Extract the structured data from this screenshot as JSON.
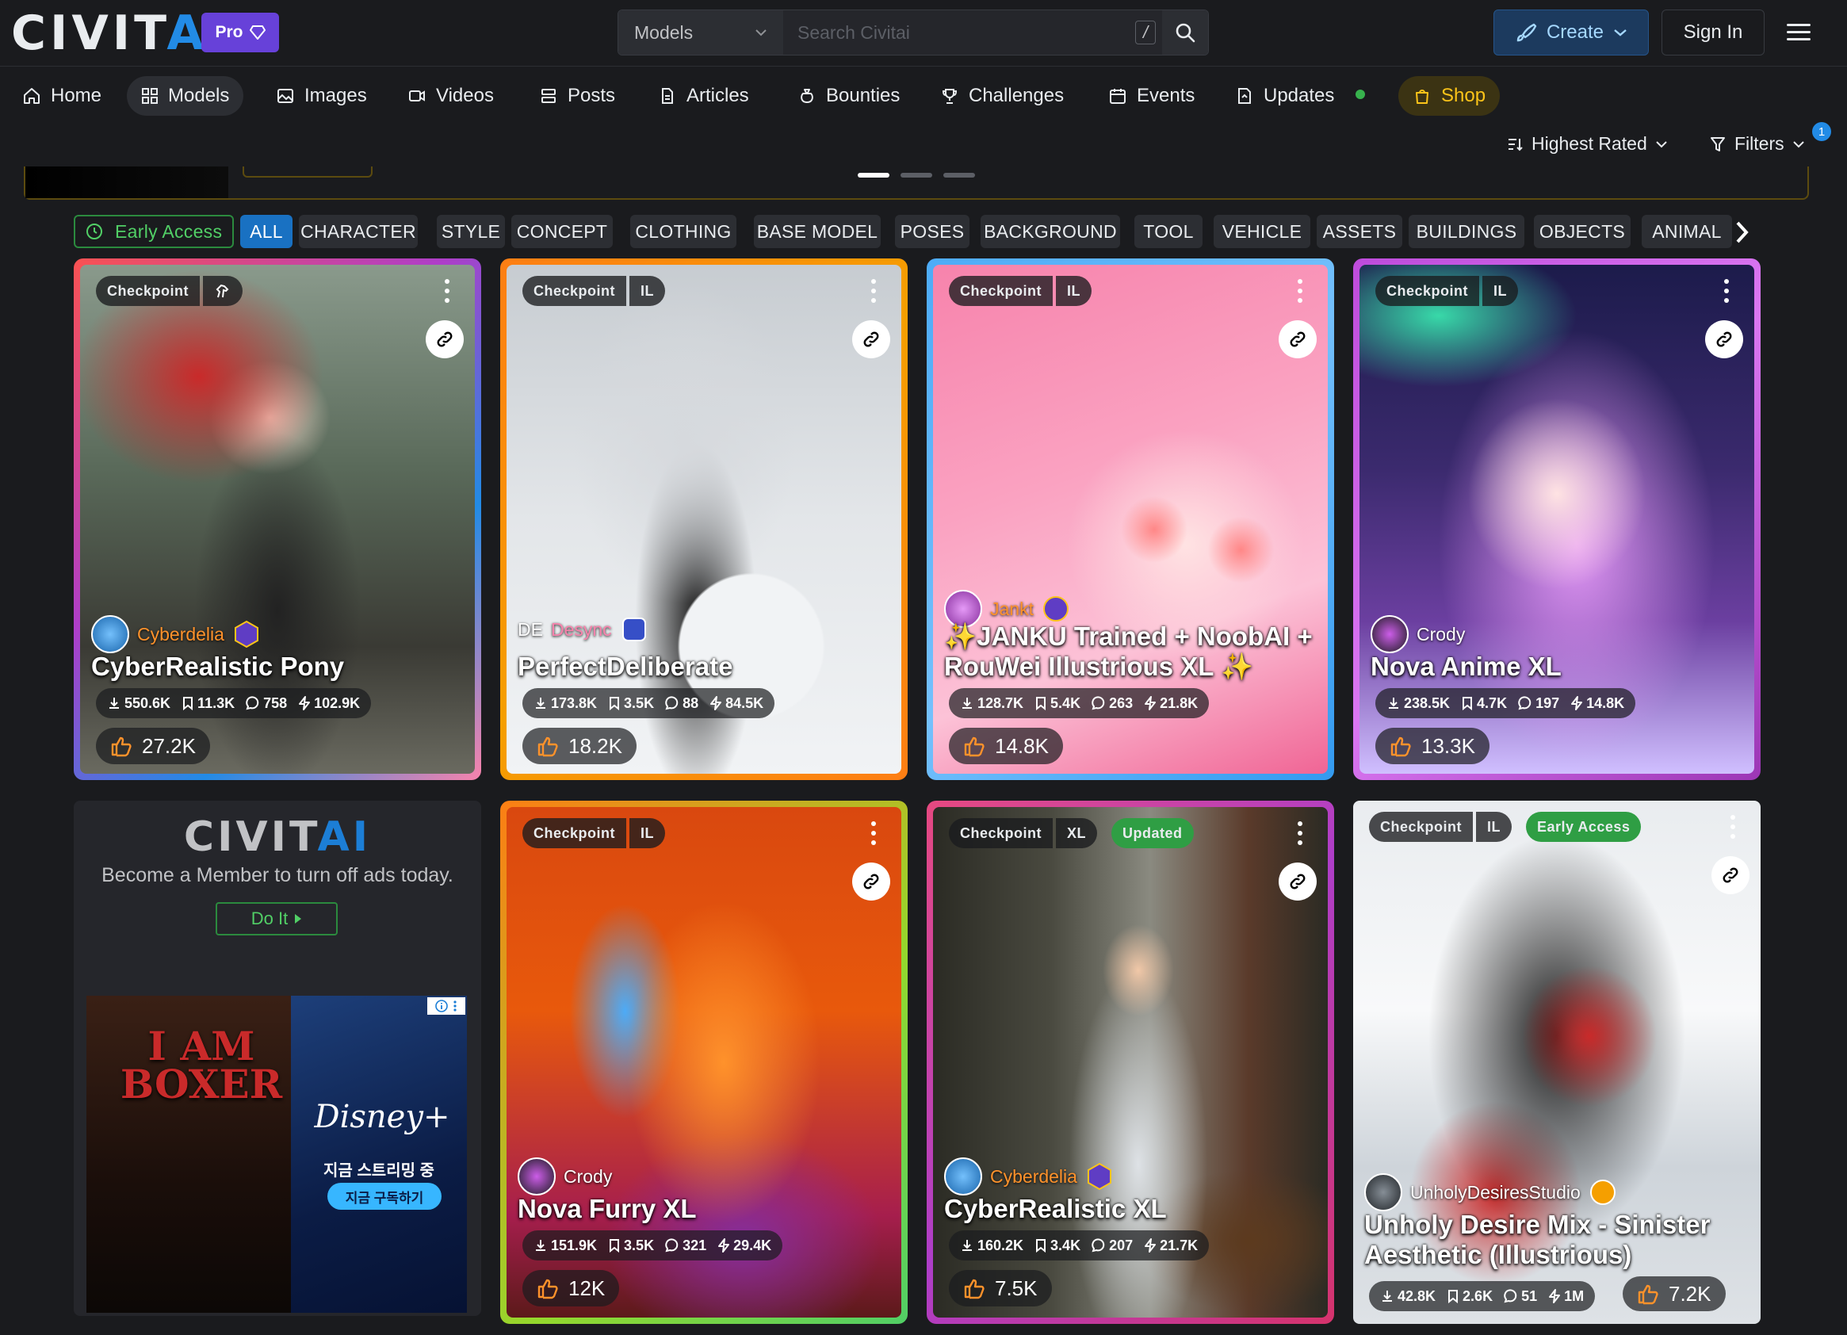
{
  "header": {
    "logo_a": "CIVIT",
    "logo_b": "AI",
    "pro_label": "Pro",
    "search_type": "Models",
    "search_placeholder": "Search Civitai",
    "search_shortcut": "/",
    "create_label": "Create",
    "signin_label": "Sign In"
  },
  "nav": {
    "home": "Home",
    "models": "Models",
    "images": "Images",
    "videos": "Videos",
    "posts": "Posts",
    "articles": "Articles",
    "bounties": "Bounties",
    "challenges": "Challenges",
    "events": "Events",
    "updates": "Updates",
    "shop": "Shop"
  },
  "sort": {
    "label": "Highest Rated",
    "filters_label": "Filters",
    "filters_count": "1"
  },
  "categories": {
    "early": "Early Access",
    "items": [
      "ALL",
      "CHARACTER",
      "STYLE",
      "CONCEPT",
      "CLOTHING",
      "BASE MODEL",
      "POSES",
      "BACKGROUND",
      "TOOL",
      "VEHICLE",
      "ASSETS",
      "BUILDINGS",
      "OBJECTS",
      "ANIMAL"
    ]
  },
  "colors": {
    "accent": "#228be6",
    "pro": "#6741d9",
    "green": "#2f9e44",
    "shop": "#fcc419",
    "creator": "#ff922b"
  },
  "cards": [
    {
      "tags": [
        "Checkpoint",
        ""
      ],
      "creator": "Cyberdelia",
      "title": [
        "CyberRealistic Pony"
      ],
      "downloads": "550.6K",
      "saves": "11.3K",
      "comments": "758",
      "buzz": "102.9K",
      "likes": "27.2K"
    },
    {
      "tags": [
        "Checkpoint",
        "IL"
      ],
      "creator": "Desync",
      "creator_prefix": "DE",
      "title": [
        "PerfectDeliberate"
      ],
      "downloads": "173.8K",
      "saves": "3.5K",
      "comments": "88",
      "buzz": "84.5K",
      "likes": "18.2K"
    },
    {
      "tags": [
        "Checkpoint",
        "IL"
      ],
      "creator": "Jankt",
      "title": [
        "✨JANKU Trained + NoobAI +",
        "RouWei Illustrious XL ✨"
      ],
      "downloads": "128.7K",
      "saves": "5.4K",
      "comments": "263",
      "buzz": "21.8K",
      "likes": "14.8K"
    },
    {
      "tags": [
        "Checkpoint",
        "IL"
      ],
      "creator": "Crody",
      "title": [
        "Nova Anime XL"
      ],
      "downloads": "238.5K",
      "saves": "4.7K",
      "comments": "197",
      "buzz": "14.8K",
      "likes": "13.3K"
    },
    {
      "tags": [
        "Checkpoint",
        "IL"
      ],
      "creator": "Crody",
      "title": [
        "Nova Furry XL"
      ],
      "downloads": "151.9K",
      "saves": "3.5K",
      "comments": "321",
      "buzz": "29.4K",
      "likes": "12K"
    },
    {
      "tags": [
        "Checkpoint",
        "XL"
      ],
      "badge": "Updated",
      "creator": "Cyberdelia",
      "title": [
        "CyberRealistic XL"
      ],
      "downloads": "160.2K",
      "saves": "3.4K",
      "comments": "207",
      "buzz": "21.7K",
      "likes": "7.5K"
    },
    {
      "tags": [
        "Checkpoint",
        "IL"
      ],
      "badge": "Early Access",
      "creator": "UnholyDesiresStudio",
      "title": [
        "Unholy Desire Mix - Sinister",
        "Aesthetic (Illustrious)"
      ],
      "downloads": "42.8K",
      "saves": "2.6K",
      "comments": "51",
      "buzz": "1M",
      "likes": "7.2K"
    }
  ],
  "ad": {
    "logo_a": "CIVIT",
    "logo_b": "AI",
    "message": "Become a Member to turn off ads today.",
    "button": "Do It",
    "img_title": "I AM BOXER",
    "img_brand": "Disney+",
    "img_line1": "지금 스트리밍 중",
    "img_line2": "지금 구독하기"
  }
}
